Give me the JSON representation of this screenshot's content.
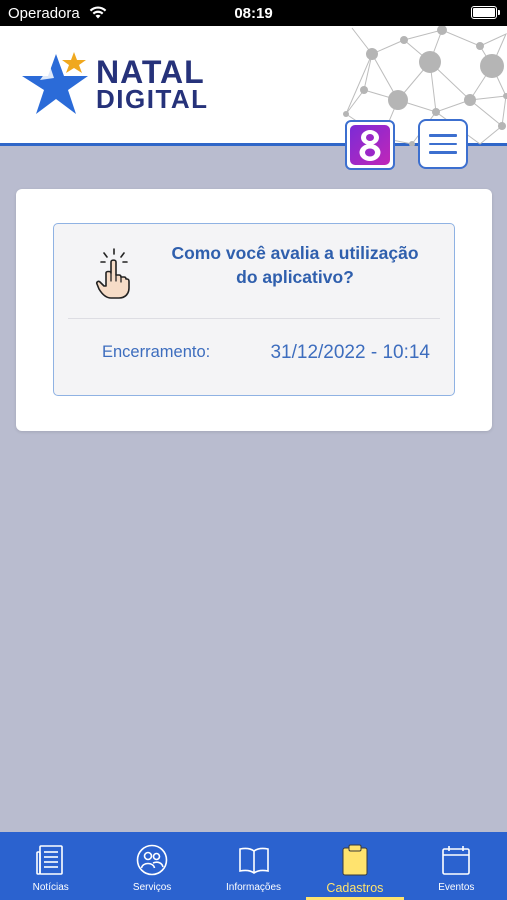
{
  "status_bar": {
    "carrier": "Operadora",
    "time": "08:19"
  },
  "header": {
    "logo": {
      "line1": "NATAL",
      "line2": "DIGITAL"
    },
    "colors": {
      "brand_blue": "#26327a",
      "accent": "#2f66c8",
      "star_blue": "#2b6bd8",
      "star_gold": "#f0a81e"
    }
  },
  "survey": {
    "title": "Como você avalia a utilização do aplicativo?",
    "closing_label": "Encerramento:",
    "closing_value": "31/12/2022 - 10:14"
  },
  "nav": {
    "items": [
      {
        "label": "Notícias",
        "icon": "newspaper-icon"
      },
      {
        "label": "Serviços",
        "icon": "people-icon"
      },
      {
        "label": "Informações",
        "icon": "book-icon"
      },
      {
        "label": "Cadastros",
        "icon": "clipboard-icon",
        "active": true
      },
      {
        "label": "Eventos",
        "icon": "calendar-icon"
      }
    ]
  }
}
